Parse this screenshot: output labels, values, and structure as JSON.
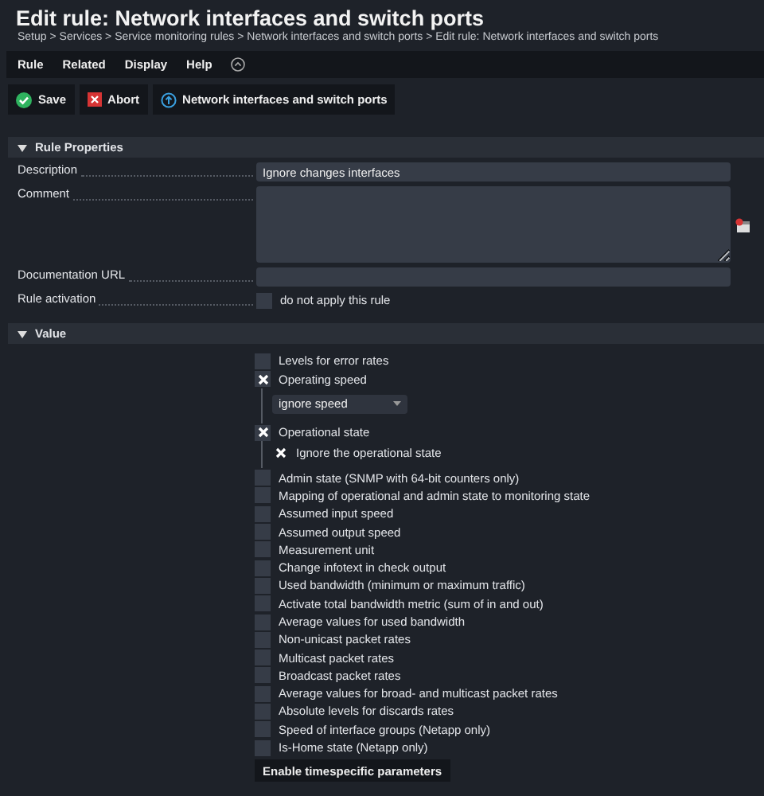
{
  "title": "Edit rule: Network interfaces and switch ports",
  "breadcrumb": "Setup > Services > Service monitoring rules > Network interfaces and switch ports > Edit rule: Network interfaces and switch ports",
  "menu": [
    "Rule",
    "Related",
    "Display",
    "Help"
  ],
  "buttons": [
    {
      "kind": "save",
      "label": "Save"
    },
    {
      "kind": "abort",
      "label": "Abort"
    },
    {
      "kind": "info",
      "label": "Network interfaces and switch ports"
    }
  ],
  "rule_properties": {
    "title": "Rule Properties",
    "expanded": true,
    "description": {
      "label": "Description",
      "value": "Ignore changes interfaces"
    },
    "comment": {
      "label": "Comment"
    },
    "documentation_url": {
      "label": "Documentation URL"
    },
    "rule_activation": {
      "label": "Rule activation",
      "option": "do not apply this rule",
      "checked": false
    }
  },
  "value": {
    "title": "Value",
    "expanded": true,
    "options": [
      {
        "kind": "checkbox",
        "label": "Levels for error rates",
        "checked": false
      },
      {
        "kind": "checkbox",
        "label": "Operating speed",
        "checked": true,
        "children": [
          {
            "kind": "dropdown",
            "value": "ignore speed"
          }
        ]
      },
      {
        "kind": "checkbox",
        "label": "Operational state",
        "checked": true,
        "children": [
          {
            "kind": "checkbox",
            "label": "Ignore the operational state",
            "checked": true
          }
        ]
      },
      {
        "kind": "checkbox",
        "label": "Admin state (SNMP with 64-bit counters only)",
        "checked": false
      },
      {
        "kind": "checkbox",
        "label": "Mapping of operational and admin state to monitoring state",
        "checked": false
      },
      {
        "kind": "checkbox",
        "label": "Assumed input speed",
        "checked": false
      },
      {
        "kind": "checkbox",
        "label": "Assumed output speed",
        "checked": false
      },
      {
        "kind": "checkbox",
        "label": "Measurement unit",
        "checked": false
      },
      {
        "kind": "checkbox",
        "label": "Change infotext in check output",
        "checked": false
      },
      {
        "kind": "checkbox",
        "label": "Used bandwidth (minimum or maximum traffic)",
        "checked": false
      },
      {
        "kind": "checkbox",
        "label": "Activate total bandwidth metric (sum of in and out)",
        "checked": false
      },
      {
        "kind": "checkbox",
        "label": "Average values for used bandwidth",
        "checked": false
      },
      {
        "kind": "checkbox",
        "label": "Non-unicast packet rates",
        "checked": false
      },
      {
        "kind": "checkbox",
        "label": "Multicast packet rates",
        "checked": false
      },
      {
        "kind": "checkbox",
        "label": "Broadcast packet rates",
        "checked": false
      },
      {
        "kind": "checkbox",
        "label": "Average values for broad- and multicast packet rates",
        "checked": false
      },
      {
        "kind": "checkbox",
        "label": "Absolute levels for discards rates",
        "checked": false
      },
      {
        "kind": "checkbox",
        "label": "Speed of interface groups (Netapp only)",
        "checked": false
      },
      {
        "kind": "checkbox",
        "label": "Is-Home state (Netapp only)",
        "checked": false
      }
    ],
    "button": "Enable timespecific parameters"
  }
}
